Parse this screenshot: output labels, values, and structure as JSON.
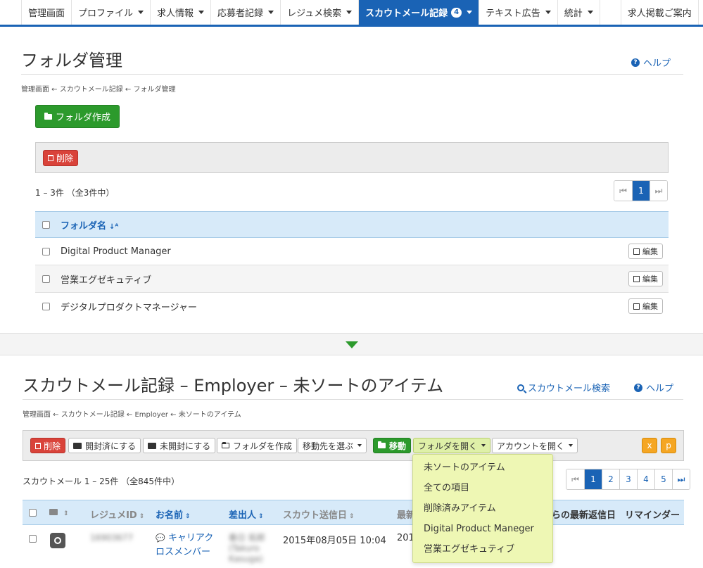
{
  "nav": {
    "items": [
      {
        "label": "管理画面",
        "dropdown": false
      },
      {
        "label": "プロファイル",
        "dropdown": true
      },
      {
        "label": "求人情報",
        "dropdown": true
      },
      {
        "label": "応募者記録",
        "dropdown": true
      },
      {
        "label": "レジュメ検索",
        "dropdown": true
      },
      {
        "label": "スカウトメール記録",
        "dropdown": true,
        "active": true,
        "badge": "4"
      },
      {
        "label": "テキスト広告",
        "dropdown": true
      },
      {
        "label": "統計",
        "dropdown": true
      }
    ],
    "right_label": "求人掲載ご案内"
  },
  "folders": {
    "title": "フォルダ管理",
    "help": "ヘルプ",
    "breadcrumb": "管理画面 ← スカウトメール記録 ← フォルダ管理",
    "create_button": "フォルダ作成",
    "delete_button": "削除",
    "count": "1 – 3件 （全3件中）",
    "pager": {
      "first": "⏮",
      "page": "1",
      "last": "⏭"
    },
    "column_header": "フォルダ名",
    "rows": [
      {
        "name": "Digital Product Manager",
        "edit": "編集"
      },
      {
        "name": "営業エグゼキュティブ",
        "edit": "編集"
      },
      {
        "name": "デジタルプロダクトマネージャー",
        "edit": "編集"
      }
    ]
  },
  "scout": {
    "title": "スカウトメール記録 – Employer – 未ソートのアイテム",
    "search_link": "スカウトメール検索",
    "help": "ヘルプ",
    "breadcrumb": "管理画面 ← スカウトメール記録 ← Employer ← 未ソートのアイテム",
    "toolbar": {
      "delete": "削除",
      "mark_opened": "開封済にする",
      "mark_unopened": "未開封にする",
      "create_folder": "フォルダを作成",
      "choose_destination": "移動先を選ぶ",
      "move": "移動",
      "open_folder": "フォルダを開く",
      "open_account": "アカウントを開く"
    },
    "count": "スカウトメール 1 – 25件 （全845件中）",
    "pager": [
      "1",
      "2",
      "3",
      "4",
      "5"
    ],
    "columns": {
      "resume_id": "レジュメID",
      "name": "お名前",
      "sender": "差出人",
      "sent_date": "スカウト送信日",
      "latest": "最新",
      "latest_reply": "らの最新返信日",
      "reminder": "リマインダー"
    },
    "row": {
      "resume_id": "16903677",
      "name_line1": "キャリアク",
      "name_line2": "ロスメンバー",
      "sender_line1": "春日 拓郎",
      "sender_line2": "(Takuro",
      "sender_line3": "Kasuga)",
      "sent_date": "2015年08月05日 10:04",
      "latest": "201"
    },
    "folder_menu": [
      "未ソートのアイテム",
      "全ての項目",
      "削除済みアイテム",
      "Digital Product Maneger",
      "営業エグゼキュティブ"
    ]
  }
}
